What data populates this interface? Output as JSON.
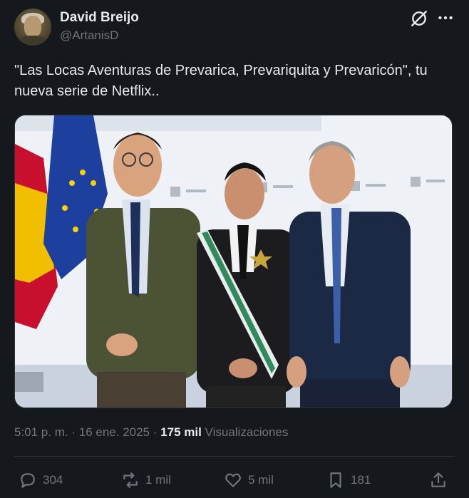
{
  "author": {
    "display_name": "David Breijo",
    "handle": "@ArtanisD"
  },
  "icons": {
    "grok": "grok-icon",
    "more": "more-options-icon",
    "reply": "reply-icon",
    "repost": "repost-icon",
    "like": "like-icon",
    "bookmark": "bookmark-icon",
    "share": "share-icon"
  },
  "tweet": {
    "text": "\"Las Locas Aventuras de Prevarica, Prevariquita y Prevaricón\", tu nueva serie de Netflix.."
  },
  "meta": {
    "time": "5:01 p. m.",
    "separator": "·",
    "date": "16 ene. 2025",
    "views_count": "175 mil",
    "views_label": "Visualizaciones"
  },
  "actions": {
    "replies": "304",
    "reposts": "1 mil",
    "likes": "5 mil",
    "bookmarks": "181"
  },
  "colors": {
    "background": "#15181c",
    "text_primary": "#e7e9ea",
    "text_secondary": "#71767b",
    "divider": "#2f3336"
  }
}
